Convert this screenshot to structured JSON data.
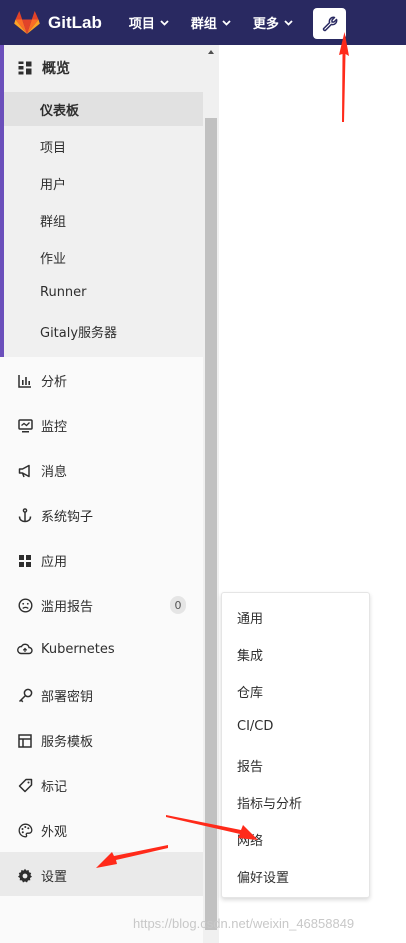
{
  "navbar": {
    "brand": "GitLab",
    "items": [
      "项目",
      "群组",
      "更多"
    ],
    "admin_icon": "wrench-icon"
  },
  "sidebar": {
    "overview": {
      "label": "概览",
      "icon": "grid-icon",
      "items": [
        "仪表板",
        "项目",
        "用户",
        "群组",
        "作业",
        "Runner",
        "Gitaly服务器"
      ],
      "active_item": "仪表板"
    },
    "items": [
      {
        "label": "分析",
        "icon": "chart-icon"
      },
      {
        "label": "监控",
        "icon": "monitor-icon"
      },
      {
        "label": "消息",
        "icon": "megaphone-icon"
      },
      {
        "label": "系统钩子",
        "icon": "anchor-icon"
      },
      {
        "label": "应用",
        "icon": "apps-icon"
      },
      {
        "label": "滥用报告",
        "icon": "frown-icon",
        "badge": "0"
      },
      {
        "label": "Kubernetes",
        "icon": "cloud-icon"
      },
      {
        "label": "部署密钥",
        "icon": "key-icon"
      },
      {
        "label": "服务模板",
        "icon": "template-icon"
      },
      {
        "label": "标记",
        "icon": "tag-icon"
      },
      {
        "label": "外观",
        "icon": "palette-icon"
      },
      {
        "label": "设置",
        "icon": "gear-icon"
      }
    ]
  },
  "settings_flyout": {
    "items": [
      "通用",
      "集成",
      "仓库",
      "CI/CD",
      "报告",
      "指标与分析",
      "网络",
      "偏好设置"
    ]
  },
  "watermark": "https://blog.csdn.net/weixin_46858849",
  "colors": {
    "navbar_bg": "#292961",
    "active_border": "#6b4fbb",
    "annotation_arrow": "#ff2a1a",
    "logo_orange": "#e24329"
  }
}
